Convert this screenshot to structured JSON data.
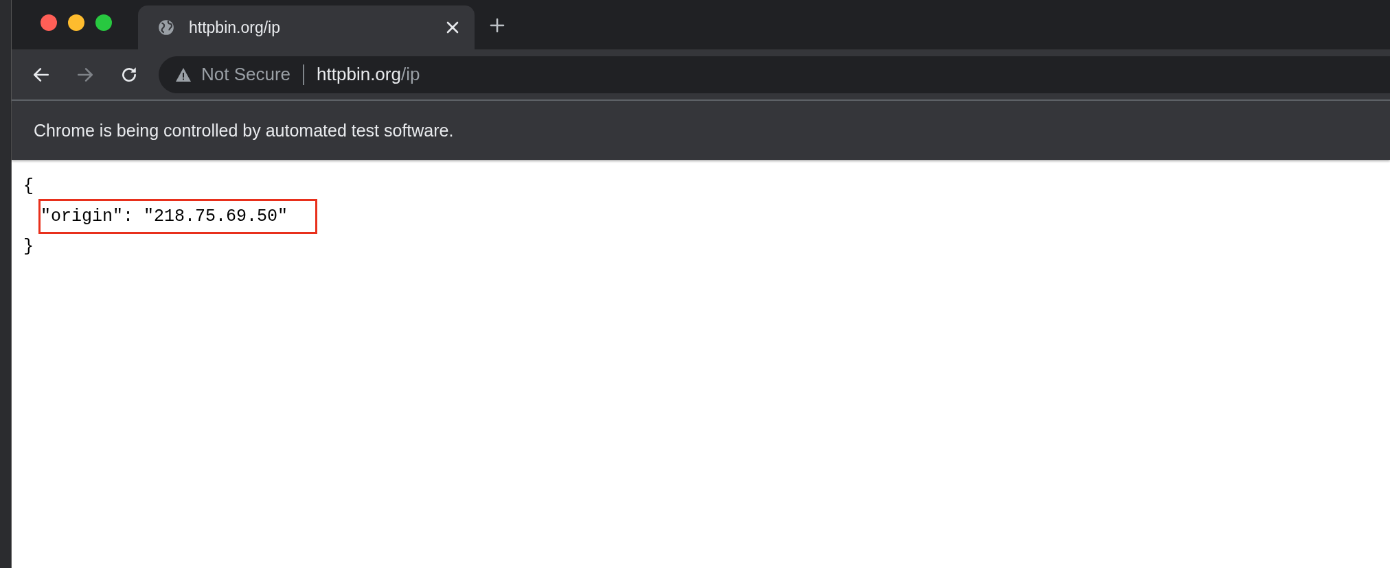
{
  "tab": {
    "title": "httpbin.org/ip"
  },
  "toolbar": {
    "security_label": "Not Secure",
    "url_host": "httpbin.org",
    "url_path": "/ip"
  },
  "infobar": {
    "message": "Chrome is being controlled by automated test software."
  },
  "content": {
    "lines": [
      {
        "text": "{",
        "indent": false,
        "highlighted": false
      },
      {
        "text": "\"origin\": \"218.75.69.50\"",
        "indent": true,
        "highlighted": true
      },
      {
        "text": "}",
        "indent": false,
        "highlighted": false
      }
    ]
  }
}
